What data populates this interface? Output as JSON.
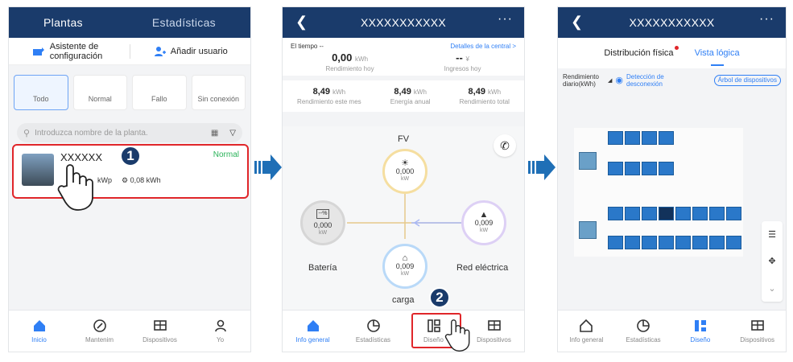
{
  "screen1": {
    "tabs": [
      "Plantas",
      "Estadísticas"
    ],
    "actions": [
      {
        "label": "Asistente de configuración",
        "icon": "wizard-icon"
      },
      {
        "label": "Añadir usuario",
        "icon": "add-user-icon"
      }
    ],
    "filters": [
      "Todo",
      "Normal",
      "Fallo",
      "Sin conexión"
    ],
    "search_placeholder": "Introduzca nombre de la planta.",
    "plant": {
      "name": "XXXXXX",
      "status": "Normal",
      "capacity": "kWp",
      "energy": "0,08 kWh"
    },
    "step": "1",
    "tabbar": [
      {
        "label": "Inicio",
        "icon": "home-icon",
        "active": true
      },
      {
        "label": "Mantenim",
        "icon": "maintenance-icon",
        "active": false
      },
      {
        "label": "Dispositivos",
        "icon": "devices-icon",
        "active": false
      },
      {
        "label": "Yo",
        "icon": "user-icon",
        "active": false
      }
    ]
  },
  "screen2": {
    "title": "XXXXXXXXXXX",
    "weather": "El tiempo  --",
    "details_link": "Detalles de la central >",
    "today_yield": {
      "value": "0,00",
      "unit": "kWh",
      "label": "Rendimiento hoy"
    },
    "today_income": {
      "value": "--",
      "unit": "¥",
      "label": "Ingresos hoy"
    },
    "month_yield": {
      "value": "8,49",
      "unit": "kWh",
      "label": "Rendimiento este mes"
    },
    "annual_energy": {
      "value": "8,49",
      "unit": "kWh",
      "label": "Energía anual"
    },
    "total_yield": {
      "value": "8,49",
      "unit": "kWh",
      "label": "Rendimiento total"
    },
    "nodes": {
      "pv": {
        "label": "FV",
        "value": "0,000",
        "unit": "kW"
      },
      "battery": {
        "label": "Batería",
        "value": "0,000",
        "unit": "kW",
        "soc": "--%"
      },
      "grid": {
        "label": "Red eléctrica",
        "value": "0,009",
        "unit": "kW"
      },
      "load": {
        "label": "carga",
        "value": "0,009",
        "unit": "kW"
      }
    },
    "step": "2",
    "tabbar": [
      {
        "label": "Info general",
        "icon": "home-icon",
        "active": true
      },
      {
        "label": "Estadísticas",
        "icon": "pie-chart-icon",
        "active": false
      },
      {
        "label": "Diseño",
        "icon": "layout-icon",
        "active": false
      },
      {
        "label": "Dispositivos",
        "icon": "devices-icon",
        "active": false
      }
    ]
  },
  "screen3": {
    "title": "XXXXXXXXXXX",
    "seg_tabs": [
      "Distribución física",
      "Vista lógica"
    ],
    "daily_yield_label": "Rendimiento diario(kWh)",
    "disconnect_label": "Detección de desconexión",
    "device_tree_label": "Árbol de dispositivos",
    "tabbar": [
      {
        "label": "Info general",
        "icon": "home-icon",
        "active": false
      },
      {
        "label": "Estadísticas",
        "icon": "pie-chart-icon",
        "active": false
      },
      {
        "label": "Diseño",
        "icon": "layout-icon",
        "active": true
      },
      {
        "label": "Dispositivos",
        "icon": "devices-icon",
        "active": false
      }
    ]
  },
  "colors": {
    "navbar": "#1a3b6b",
    "accent": "#2f7ff5",
    "highlight": "#e0262a",
    "ok": "#2bb35a"
  }
}
